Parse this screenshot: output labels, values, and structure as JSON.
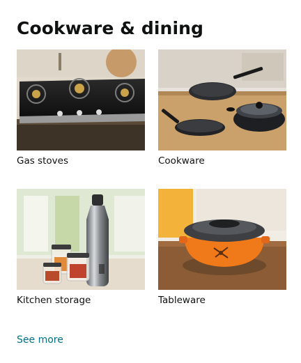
{
  "card": {
    "title": "Cookware & dining",
    "tiles": [
      {
        "label": "Gas stoves",
        "image_icon": "gas-stove-photo"
      },
      {
        "label": "Cookware",
        "image_icon": "cookware-photo"
      },
      {
        "label": "Kitchen storage",
        "image_icon": "kitchen-storage-photo"
      },
      {
        "label": "Tableware",
        "image_icon": "tableware-photo"
      }
    ],
    "see_more": "See more",
    "link_color": "#007185"
  }
}
